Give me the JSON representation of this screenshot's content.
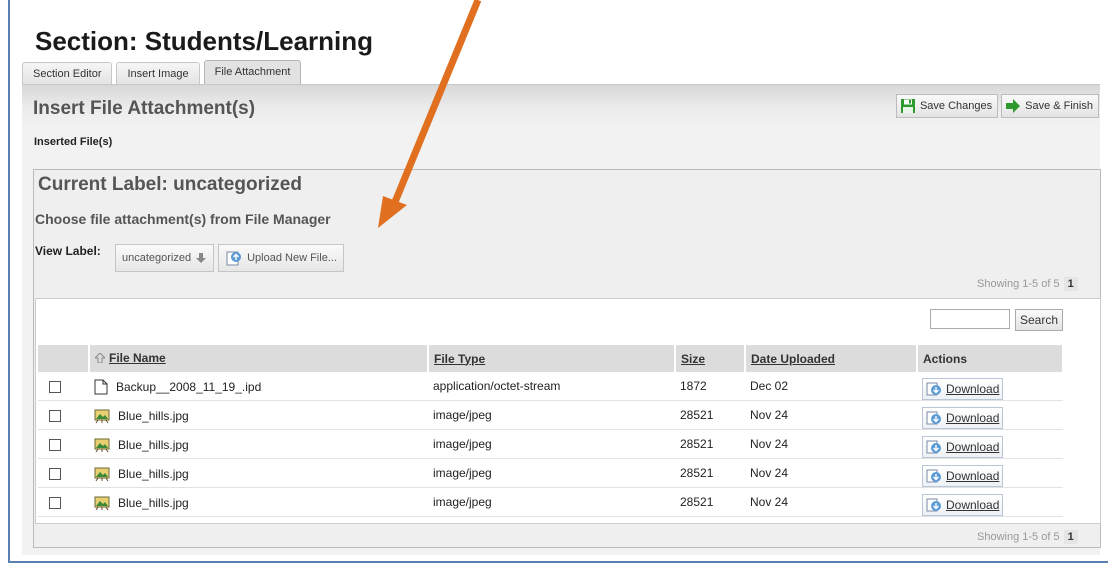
{
  "page": {
    "title": "Section: Students/Learning",
    "tabs": [
      {
        "label": "Section Editor"
      },
      {
        "label": "Insert Image"
      },
      {
        "label": "File Attachment"
      }
    ],
    "heading": "Insert File Attachment(s)",
    "inserted_label": "Inserted File(s)"
  },
  "toolbar": {
    "save_changes": "Save Changes",
    "save_finish": "Save & Finish"
  },
  "file_manager": {
    "current_label": "Current Label:  uncategorized",
    "choose_text": "Choose file attachment(s) from File Manager",
    "view_label": "View Label:",
    "view_selected": "uncategorized",
    "upload_button": "Upload New File...",
    "showing_text": "Showing 1-5 of 5",
    "page_number": "1",
    "search_button": "Search",
    "search_value": ""
  },
  "table": {
    "headers": {
      "file_name": "File Name",
      "file_type": "File Type",
      "size": "Size",
      "date": "Date Uploaded",
      "actions": "Actions"
    },
    "rows": [
      {
        "name": "Backup__2008_11_19_.ipd",
        "type": "application/octet-stream",
        "size": "1872",
        "date": "Dec 02",
        "action": "Download",
        "icon": "document-icon"
      },
      {
        "name": "Blue_hills.jpg",
        "type": "image/jpeg",
        "size": "28521",
        "date": "Nov 24",
        "action": "Download",
        "icon": "image-icon"
      },
      {
        "name": "Blue_hills.jpg",
        "type": "image/jpeg",
        "size": "28521",
        "date": "Nov 24",
        "action": "Download",
        "icon": "image-icon"
      },
      {
        "name": "Blue_hills.jpg",
        "type": "image/jpeg",
        "size": "28521",
        "date": "Nov 24",
        "action": "Download",
        "icon": "image-icon"
      },
      {
        "name": "Blue_hills.jpg",
        "type": "image/jpeg",
        "size": "28521",
        "date": "Nov 24",
        "action": "Download",
        "icon": "image-icon"
      }
    ]
  },
  "colors": {
    "annotation_arrow": "#e07020",
    "frame_border": "#5b7fb0",
    "save_icon_green": "#2e9a2e"
  }
}
